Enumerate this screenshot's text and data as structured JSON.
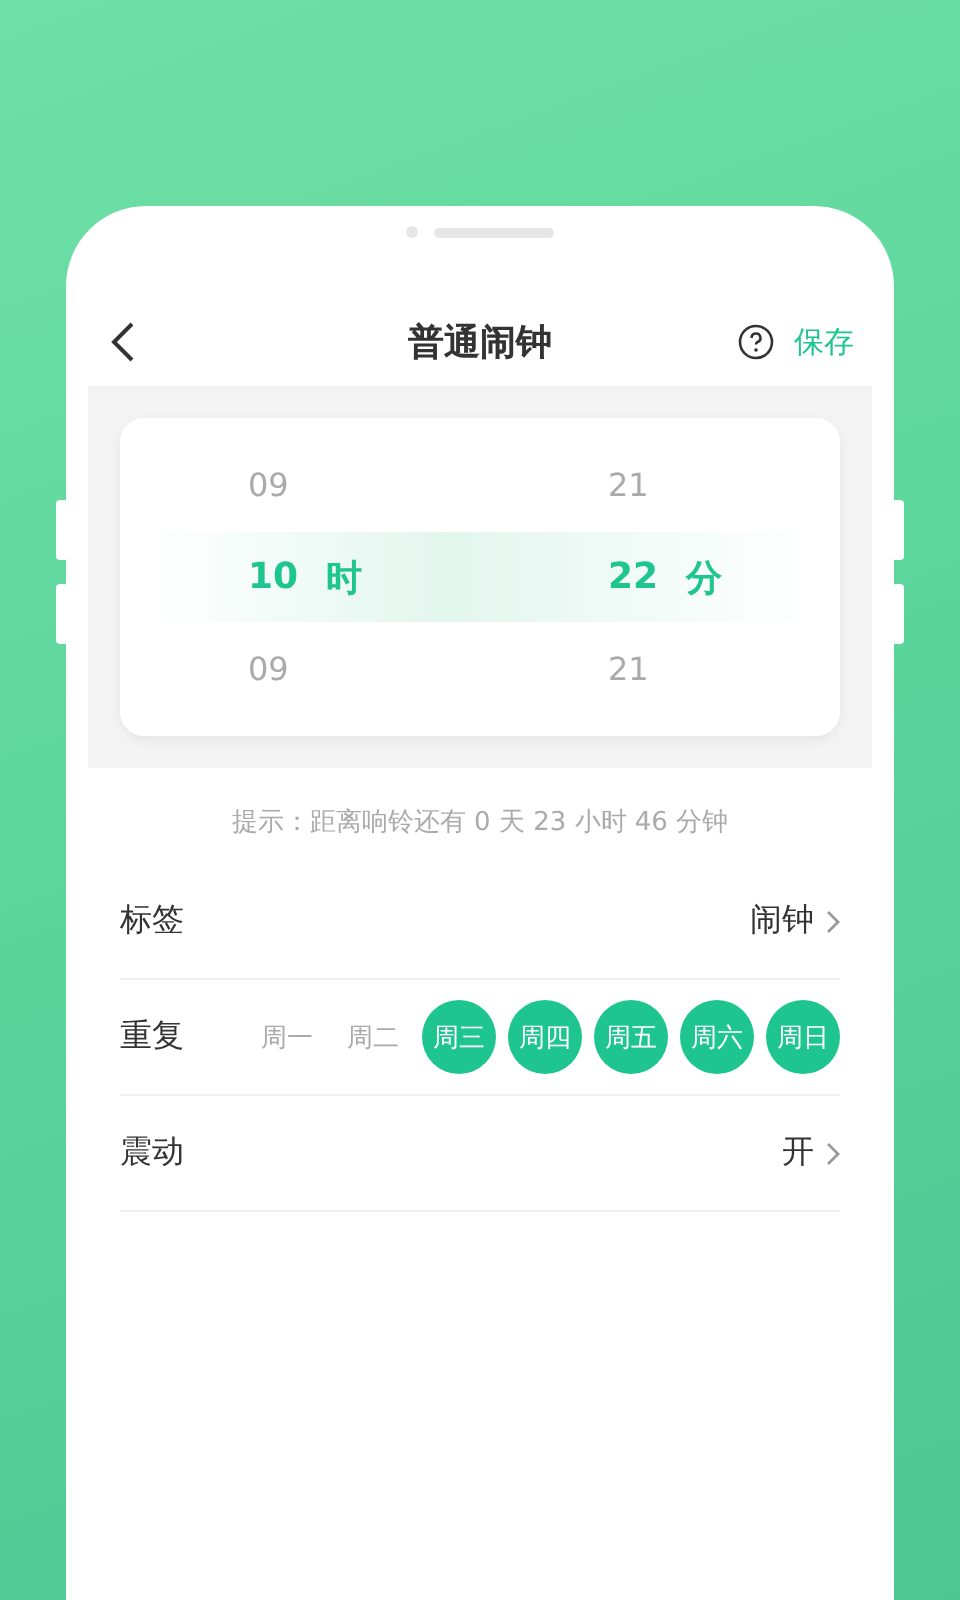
{
  "header": {
    "title": "普通闹钟",
    "save": "保存"
  },
  "picker": {
    "columns": [
      {
        "above": "09",
        "value": "10",
        "unit": "时",
        "below": "09"
      },
      {
        "above": "21",
        "value": "22",
        "unit": "分",
        "below": "21"
      }
    ]
  },
  "hint": "提示：距离响铃还有 0 天 23 小时 46 分钟",
  "settings": [
    {
      "kind": "link",
      "label": "标签",
      "value": "闹钟"
    },
    {
      "kind": "days",
      "label": "重复",
      "days": [
        {
          "label": "周一",
          "selected": false
        },
        {
          "label": "周二",
          "selected": false
        },
        {
          "label": "周三",
          "selected": true
        },
        {
          "label": "周四",
          "selected": true
        },
        {
          "label": "周五",
          "selected": true
        },
        {
          "label": "周六",
          "selected": true
        },
        {
          "label": "周日",
          "selected": true
        }
      ]
    },
    {
      "kind": "link",
      "label": "震动",
      "value": "开"
    }
  ]
}
